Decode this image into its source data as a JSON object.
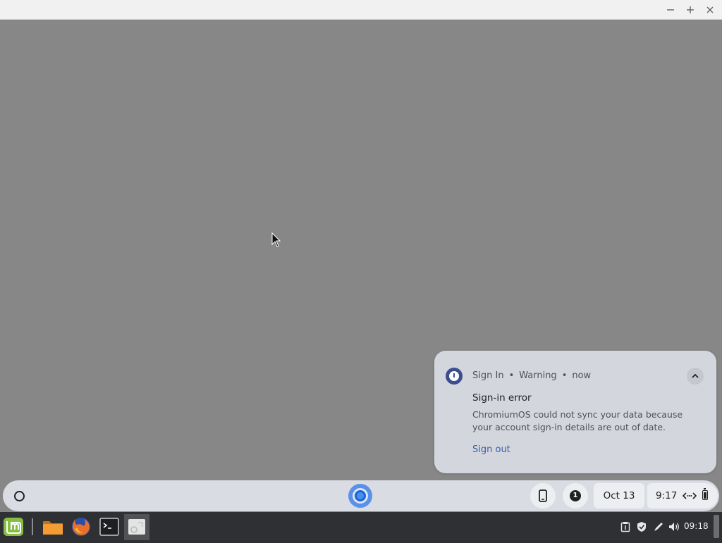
{
  "window": {
    "controls": [
      "minimize-icon",
      "maximize-icon",
      "close-icon"
    ],
    "background_color": "#878787"
  },
  "notification": {
    "source": "Sign In",
    "severity": "Warning",
    "time": "now",
    "title": "Sign-in error",
    "body": "ChromiumOS could not sync your data because your account sign-in details are out of date.",
    "action": "Sign out",
    "icon": "warning-circle-icon",
    "accent_color": "#3c4e8c"
  },
  "shelf": {
    "launcher_icon": "launcher-circle-icon",
    "pinned_app_icon": "chromium-icon",
    "phone_icon": "phone-hub-icon",
    "notification_count": "1",
    "date": "Oct 13",
    "time": "9:17",
    "network_icon": "ethernet-icon",
    "battery_icon": "battery-icon"
  },
  "taskbar": {
    "apps": [
      "linux-mint-menu-icon",
      "files-icon",
      "firefox-icon",
      "terminal-icon",
      "app-window-icon"
    ],
    "tray_icons": [
      "clipboard-icon",
      "shield-icon",
      "pen-icon",
      "volume-icon"
    ],
    "clock": "09:18"
  }
}
